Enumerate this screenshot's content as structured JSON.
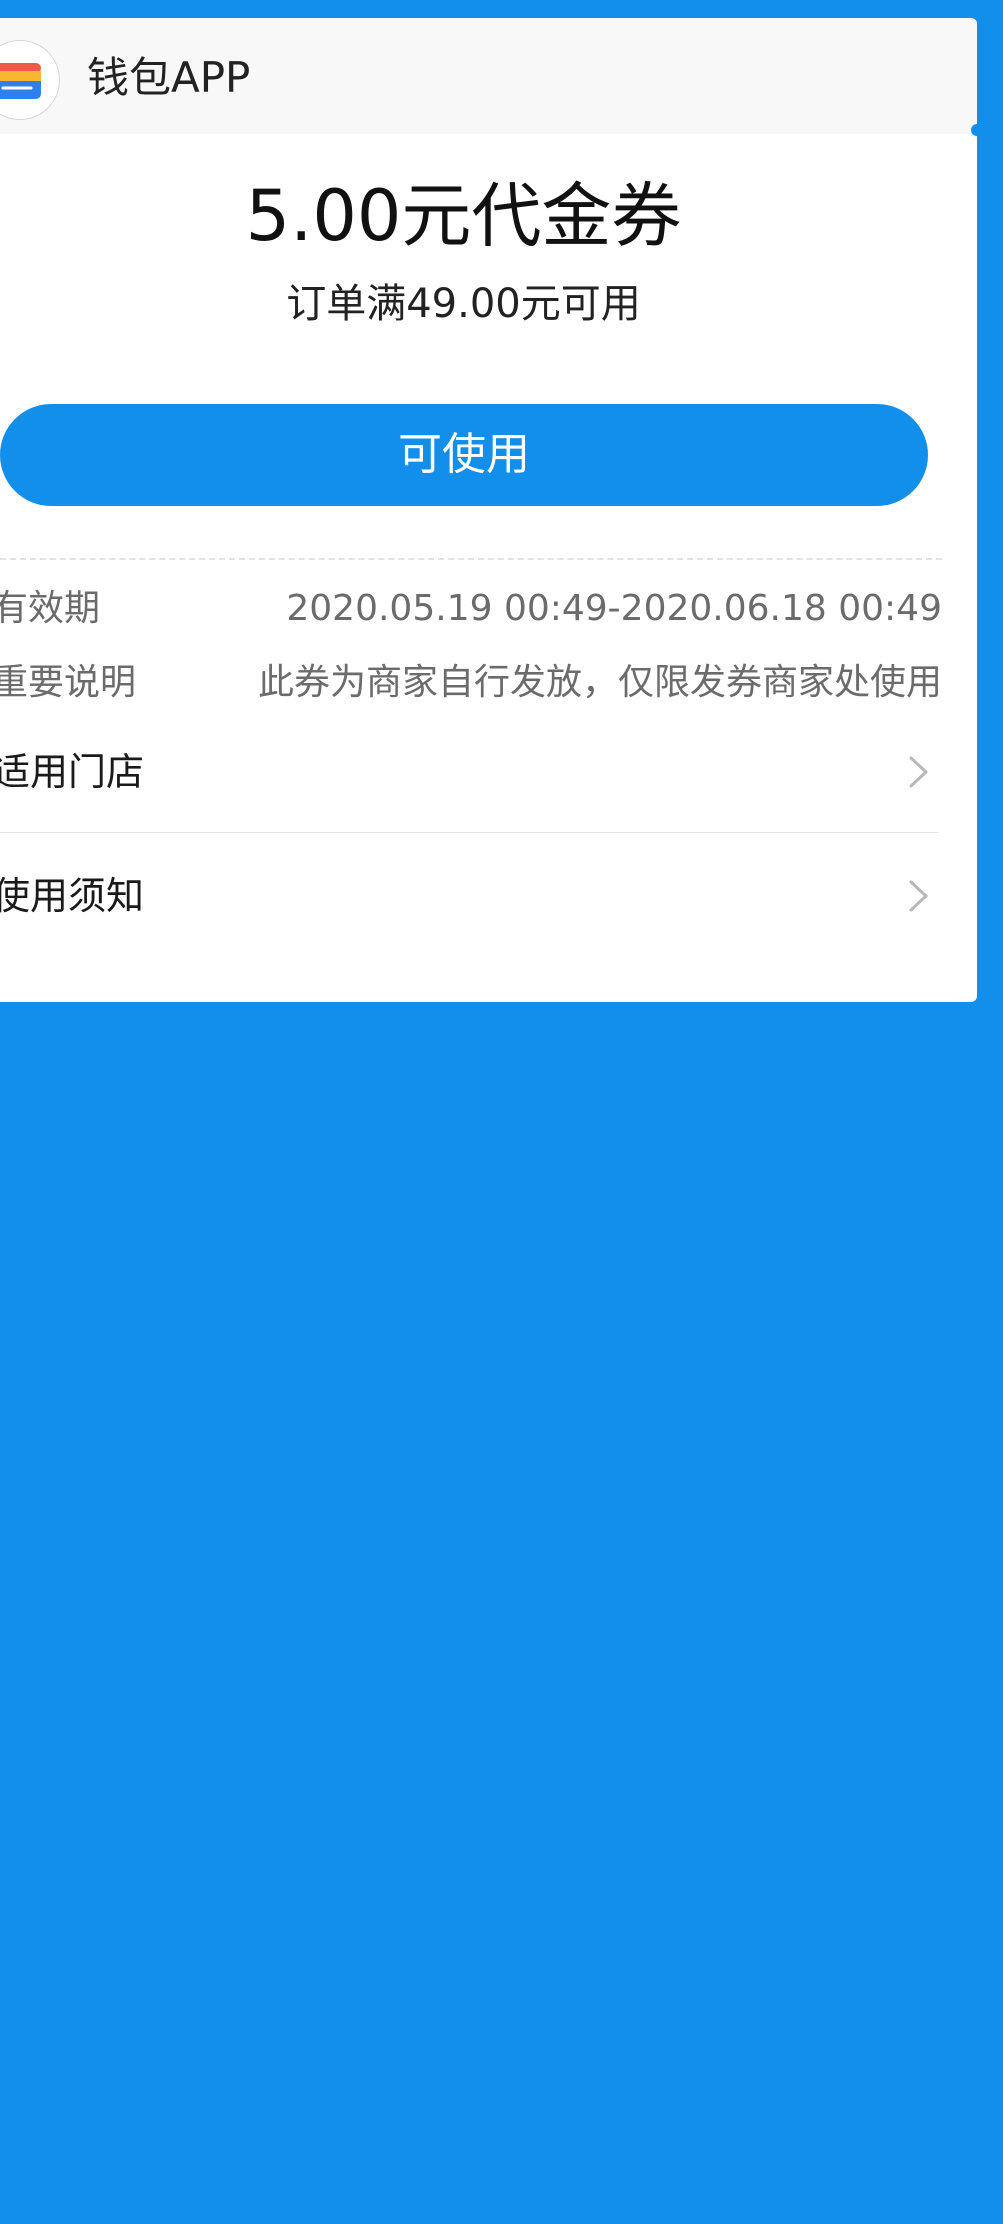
{
  "header": {
    "app_name": "钱包APP",
    "logo_icon": "wallet-logo-icon"
  },
  "coupon": {
    "title": "5.00元代金券",
    "condition": "订单满49.00元可用",
    "button_label": "可使用"
  },
  "details": {
    "validity_label": "有效期",
    "validity_value": "2020.05.19 00:49-2020.06.18 00:49",
    "notice_label": "重要说明",
    "notice_value": "此券为商家自行发放，仅限发券商家处使用"
  },
  "nav": {
    "stores_label": "适用门店",
    "usage_label": "使用须知",
    "chevron_icon": "chevron-right-icon"
  },
  "colors": {
    "background": "#128fea",
    "card": "#ffffff",
    "header": "#f8f8f8",
    "accent": "#128fea"
  }
}
